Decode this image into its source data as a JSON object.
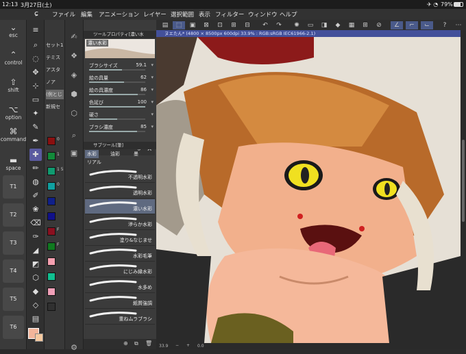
{
  "status": {
    "time": "12:13",
    "date": "3月27日(土)",
    "battery": "79%"
  },
  "menu": [
    "ファイル",
    "編集",
    "アニメーション",
    "レイヤー",
    "選択範囲",
    "表示",
    "フィルター",
    "ウィンドウ",
    "ヘルプ"
  ],
  "modifiers": [
    {
      "glyph": "⌄",
      "label": "esc"
    },
    {
      "glyph": "⌃",
      "label": "control"
    },
    {
      "glyph": "⇧",
      "label": "shift"
    },
    {
      "glyph": "⌥",
      "label": "option"
    },
    {
      "glyph": "⌘",
      "label": "command"
    },
    {
      "glyph": "▬",
      "label": "space"
    }
  ],
  "tkeys": [
    "T1",
    "T2",
    "T3",
    "T4",
    "T5",
    "T6"
  ],
  "sets": [
    "セット1",
    "テミス",
    "アスタ",
    "ノア",
    "(例とじ",
    "新規セ"
  ],
  "swatches": [
    {
      "color": "#8a1010",
      "n": "0"
    },
    {
      "color": "#128a3a",
      "n": "1"
    },
    {
      "color": "#109a70",
      "n": "1\n5"
    },
    {
      "color": "#10a0a0",
      "n": "0"
    },
    {
      "color": "#10208a",
      "n": ""
    },
    {
      "color": "#10108a",
      "n": ""
    },
    {
      "color": "#8a1020",
      "n": "F"
    },
    {
      "color": "#107a20",
      "n": "F"
    },
    {
      "color": "#f5a0b0",
      "n": ""
    },
    {
      "color": "#10c090",
      "n": ""
    },
    {
      "color": "#f0a0b8",
      "n": ""
    },
    {
      "color": "#303030",
      "n": ""
    }
  ],
  "toolprop": {
    "title": "ツールプロパティ[濃い水",
    "brushname": "濃い水彩",
    "params": [
      {
        "label": "ブラシサイズ",
        "value": "59.1",
        "pct": 0.59
      },
      {
        "label": "絵の具量",
        "value": "62",
        "pct": 0.62
      },
      {
        "label": "絵の具濃度",
        "value": "86",
        "pct": 0.86
      },
      {
        "label": "色延び",
        "value": "100",
        "pct": 1.0
      },
      {
        "label": "硬さ",
        "value": "",
        "pct": 0.5
      },
      {
        "label": "ブラシ濃度",
        "value": "85",
        "pct": 0.85
      }
    ]
  },
  "subtool": {
    "title": "サブツール[筆]",
    "tabs": [
      "水彩",
      "油彩",
      "墨",
      "リアル"
    ],
    "brushes": [
      "不透明水彩",
      "透明水彩",
      "濃い水彩",
      "滲らか水彩",
      "塗り&なじませ",
      "水彩毛筆",
      "にじみ縁水彩",
      "水多め",
      "紙質強調",
      "重ねムラブラシ"
    ],
    "selected": 2
  },
  "doc": {
    "title": "ヌエたん* (4800 × 8500px 600dpi 33.9% : RGB:sRGB IEC61966-2.1)",
    "zoom": "33.9",
    "angle": "0.0"
  }
}
